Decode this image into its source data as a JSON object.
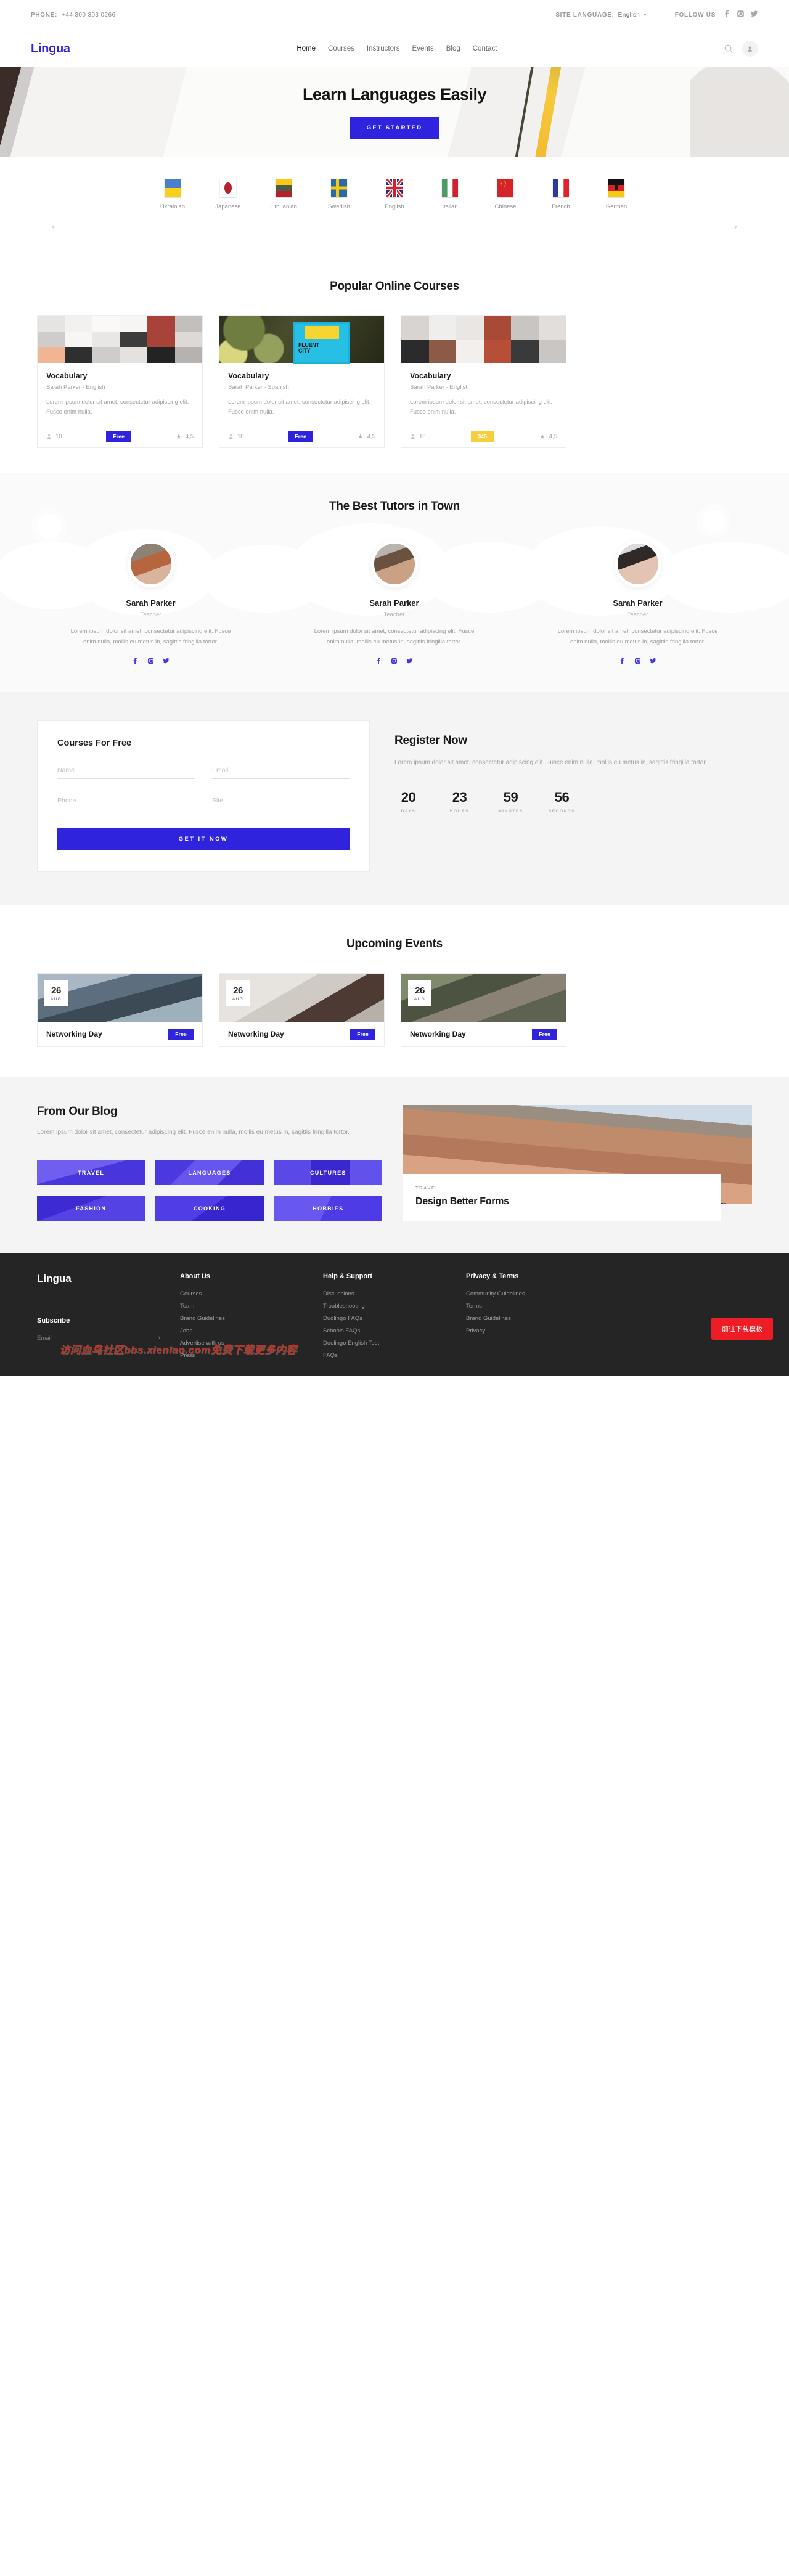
{
  "topbar": {
    "phone_label": "PHONE:",
    "phone_value": "+44 300 303 0266",
    "language_label": "SITE LANGUAGE:",
    "language_value": "English",
    "follow_label": "FOLLOW US"
  },
  "header": {
    "logo": "Lingua",
    "nav": [
      {
        "label": "Home",
        "active": true
      },
      {
        "label": "Courses",
        "active": false
      },
      {
        "label": "Instructors",
        "active": false
      },
      {
        "label": "Events",
        "active": false
      },
      {
        "label": "Blog",
        "active": false
      },
      {
        "label": "Contact",
        "active": false
      }
    ]
  },
  "hero": {
    "title": "Learn Languages Easily",
    "cta": "GET STARTED"
  },
  "languages": {
    "items": [
      {
        "name": "Ukrainian"
      },
      {
        "name": "Japanese"
      },
      {
        "name": "Lithuanian"
      },
      {
        "name": "Swedish"
      },
      {
        "name": "English"
      },
      {
        "name": "Italian"
      },
      {
        "name": "Chinese"
      },
      {
        "name": "French"
      },
      {
        "name": "German"
      }
    ],
    "prev": "‹",
    "next": "›"
  },
  "courses": {
    "title": "Popular Online Courses",
    "items": [
      {
        "title": "Vocabulary",
        "meta": "Sarah Parker · English",
        "desc": "Lorem ipsum dolor sit amet, consectetur adipiscing elit. Fusce enim nulla.",
        "students": "10",
        "price": "Free",
        "rating": "4,5"
      },
      {
        "title": "Vocabulary",
        "meta": "Sarah Parker · Spanish",
        "desc": "Lorem ipsum dolor sit amet, consectetur adipiscing elit. Fusce enim nulla.",
        "students": "10",
        "price": "Free",
        "rating": "4,5"
      },
      {
        "title": "Vocabulary",
        "meta": "Sarah Parker · English",
        "desc": "Lorem ipsum dolor sit amet, consectetur adipiscing elit. Fusce enim nulla.",
        "students": "10",
        "price": "$45",
        "rating": "4,5"
      }
    ]
  },
  "tutors": {
    "title": "The Best Tutors in Town",
    "items": [
      {
        "name": "Sarah Parker",
        "role": "Teacher",
        "desc": "Lorem ipsum dolor sit amet, consectetur adipiscing elit. Fusce enim nulla, mollis eu metus in, sagittis fringilla tortor."
      },
      {
        "name": "Sarah Parker",
        "role": "Teacher",
        "desc": "Lorem ipsum dolor sit amet, consectetur adipiscing elit. Fusce enim nulla, mollis eu metus in, sagittis fringilla tortor."
      },
      {
        "name": "Sarah Parker",
        "role": "Teacher",
        "desc": "Lorem ipsum dolor sit amet, consectetur adipiscing elit. Fusce enim nulla, mollis eu metus in, sagittis fringilla tortor."
      }
    ]
  },
  "register": {
    "form_title": "Courses For Free",
    "fields": {
      "name": "Name",
      "email": "Email",
      "phone": "Phone",
      "site": "Site"
    },
    "submit": "GET IT NOW",
    "title": "Register Now",
    "desc": "Lorem ipsum dolor sit amet, consectetur adipiscing elit. Fusce enim nulla, mollis eu metus in, sagittis fringilla tortor.",
    "countdown": [
      {
        "value": "20",
        "label": "DAYS"
      },
      {
        "value": "23",
        "label": "HOURS"
      },
      {
        "value": "59",
        "label": "MINUTES"
      },
      {
        "value": "56",
        "label": "SECONDS"
      }
    ]
  },
  "events": {
    "title": "Upcoming Events",
    "items": [
      {
        "day": "26",
        "month": "AUG",
        "name": "Networking Day",
        "price": "Free"
      },
      {
        "day": "26",
        "month": "AUG",
        "name": "Networking Day",
        "price": "Free"
      },
      {
        "day": "26",
        "month": "AUG",
        "name": "Networking Day",
        "price": "Free"
      }
    ]
  },
  "blog": {
    "title": "From Our Blog",
    "desc": "Lorem ipsum dolor sit amet, consectetur adipiscing elit. Fusce enim nulla, mollis eu metus in, sagittis fringilla tortor.",
    "categories": [
      "TRAVEL",
      "LANGUAGES",
      "CULTURES",
      "FASHION",
      "COOKING",
      "HOBBIES"
    ],
    "featured": {
      "category": "TRAVEL",
      "title": "Design Better Forms"
    }
  },
  "footer": {
    "logo": "Lingua",
    "subscribe_title": "Subscribe",
    "subscribe_placeholder": "Email",
    "subscribe_arrow": "›",
    "columns": [
      {
        "title": "About Us",
        "links": [
          "Courses",
          "Team",
          "Brand Guidelines",
          "Jobs",
          "Advertise with us",
          "Press"
        ]
      },
      {
        "title": "Help & Support",
        "links": [
          "Discussions",
          "Troubleshooting",
          "Duolingo FAQs",
          "Schools FAQs",
          "Duolingo English Test",
          "FAQs"
        ]
      },
      {
        "title": "Privacy & Terms",
        "links": [
          "Community Guidelines",
          "Terms",
          "Brand Guidelines",
          "Privacy"
        ]
      }
    ],
    "download_badge": "前往下载模板",
    "watermark": "访问血鸟社区bbs.xienIao.com免费下载更多内容"
  },
  "colors": {
    "accent": "#3023dd",
    "yellow": "#f5cf3d",
    "footer_bg": "#252525",
    "badge_red": "#ee1c25"
  }
}
